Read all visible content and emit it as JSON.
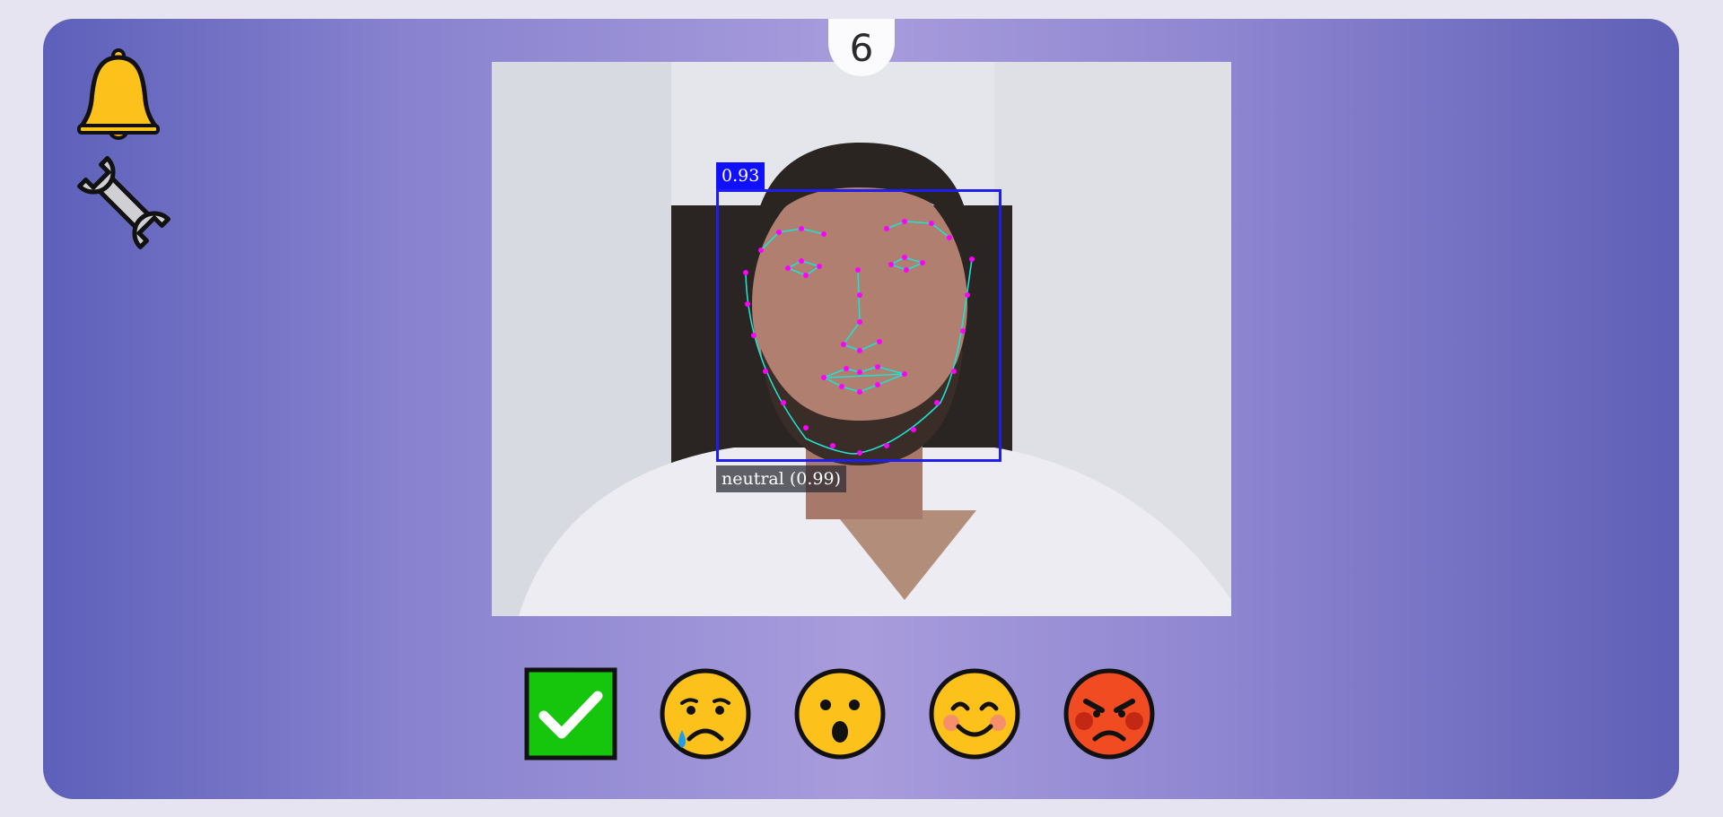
{
  "counter": "6",
  "detection": {
    "score": "0.93",
    "emotion_label": "neutral (0.99)"
  },
  "toolbar": {
    "icons": [
      "bell-icon",
      "wrench-icon"
    ]
  },
  "choices": [
    "check-icon",
    "crying-face-icon",
    "surprised-face-icon",
    "smiling-face-icon",
    "angry-face-icon"
  ],
  "colors": {
    "box": "#1e1ef0",
    "landmark": "#ff00ff",
    "mesh": "#20e0d0",
    "check_green": "#16c60c"
  }
}
